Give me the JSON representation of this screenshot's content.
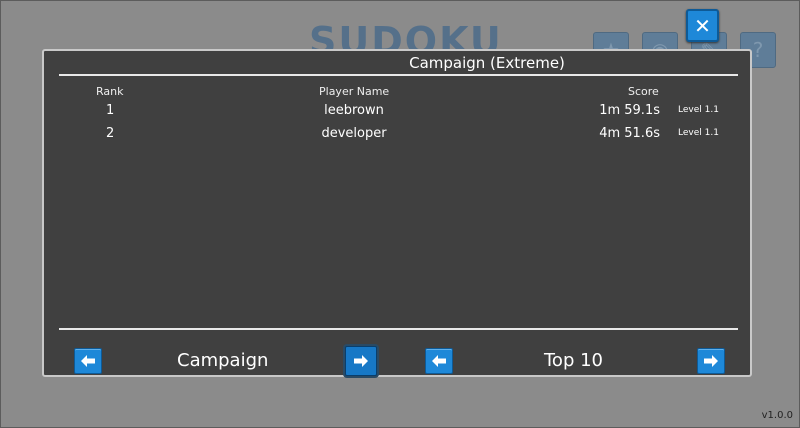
{
  "background": {
    "game_title": "SUDOKU",
    "version": "v1.0.0"
  },
  "leaderboard": {
    "title": "Campaign  (Extreme)",
    "columns": {
      "rank": "Rank",
      "player": "Player Name",
      "score": "Score"
    },
    "rows": [
      {
        "rank": "1",
        "player": "leebrown",
        "score": "1m 59.1s",
        "level": "Level 1.1"
      },
      {
        "rank": "2",
        "player": "developer",
        "score": "4m 51.6s",
        "level": "Level 1.1"
      }
    ]
  },
  "footer": {
    "mode_label": "Campaign",
    "range_label": "Top 10"
  },
  "colors": {
    "accent": "#1e88d8",
    "panel": "#404040"
  }
}
